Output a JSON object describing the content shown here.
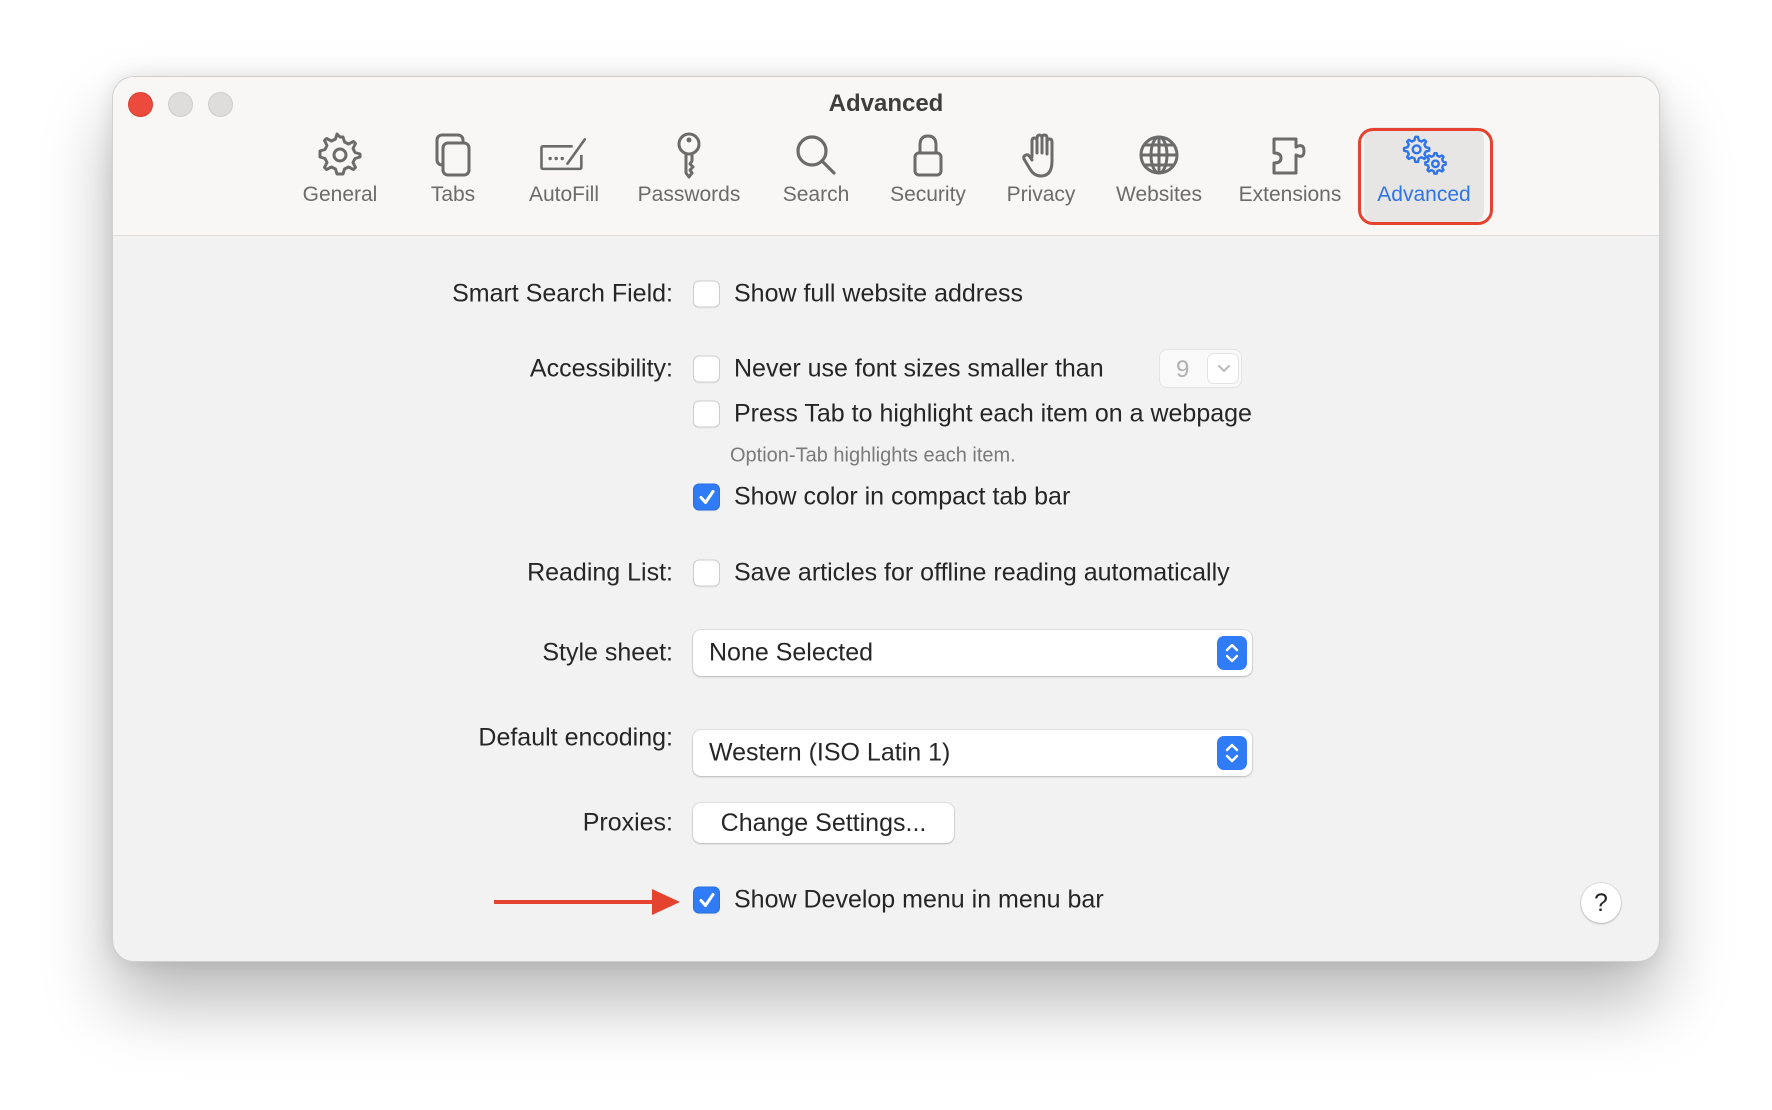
{
  "window": {
    "title": "Advanced",
    "controls": [
      "close",
      "minimize",
      "zoom"
    ]
  },
  "toolbar": {
    "tabs": [
      {
        "label": "General",
        "icon": "gear-icon"
      },
      {
        "label": "Tabs",
        "icon": "tabs-icon"
      },
      {
        "label": "AutoFill",
        "icon": "autofill-icon"
      },
      {
        "label": "Passwords",
        "icon": "key-icon"
      },
      {
        "label": "Search",
        "icon": "magnifier-icon"
      },
      {
        "label": "Security",
        "icon": "lock-icon"
      },
      {
        "label": "Privacy",
        "icon": "hand-icon"
      },
      {
        "label": "Websites",
        "icon": "globe-icon"
      },
      {
        "label": "Extensions",
        "icon": "puzzle-icon"
      },
      {
        "label": "Advanced",
        "icon": "gears-icon",
        "active": true
      }
    ],
    "accent_color": "#2f74e8",
    "annotation_color": "#e5432f"
  },
  "settings": {
    "smart_search": {
      "label": "Smart Search Field:",
      "options": [
        {
          "text": "Show full website address",
          "checked": false
        }
      ]
    },
    "accessibility": {
      "label": "Accessibility:",
      "options": [
        {
          "text": "Never use font sizes smaller than",
          "checked": false
        },
        {
          "text": "Press Tab to highlight each item on a webpage",
          "checked": false
        },
        {
          "text": "Show color in compact tab bar",
          "checked": true
        }
      ],
      "font_size_value": "9",
      "hint": "Option-Tab highlights each item."
    },
    "reading_list": {
      "label": "Reading List:",
      "options": [
        {
          "text": "Save articles for offline reading automatically",
          "checked": false
        }
      ]
    },
    "style_sheet": {
      "label": "Style sheet:",
      "value": "None Selected"
    },
    "default_encoding": {
      "label": "Default encoding:",
      "value": "Western (ISO Latin 1)"
    },
    "proxies": {
      "label": "Proxies:",
      "button": "Change Settings..."
    },
    "develop_menu": {
      "text": "Show Develop menu in menu bar",
      "checked": true
    }
  },
  "help": {
    "label": "?"
  }
}
